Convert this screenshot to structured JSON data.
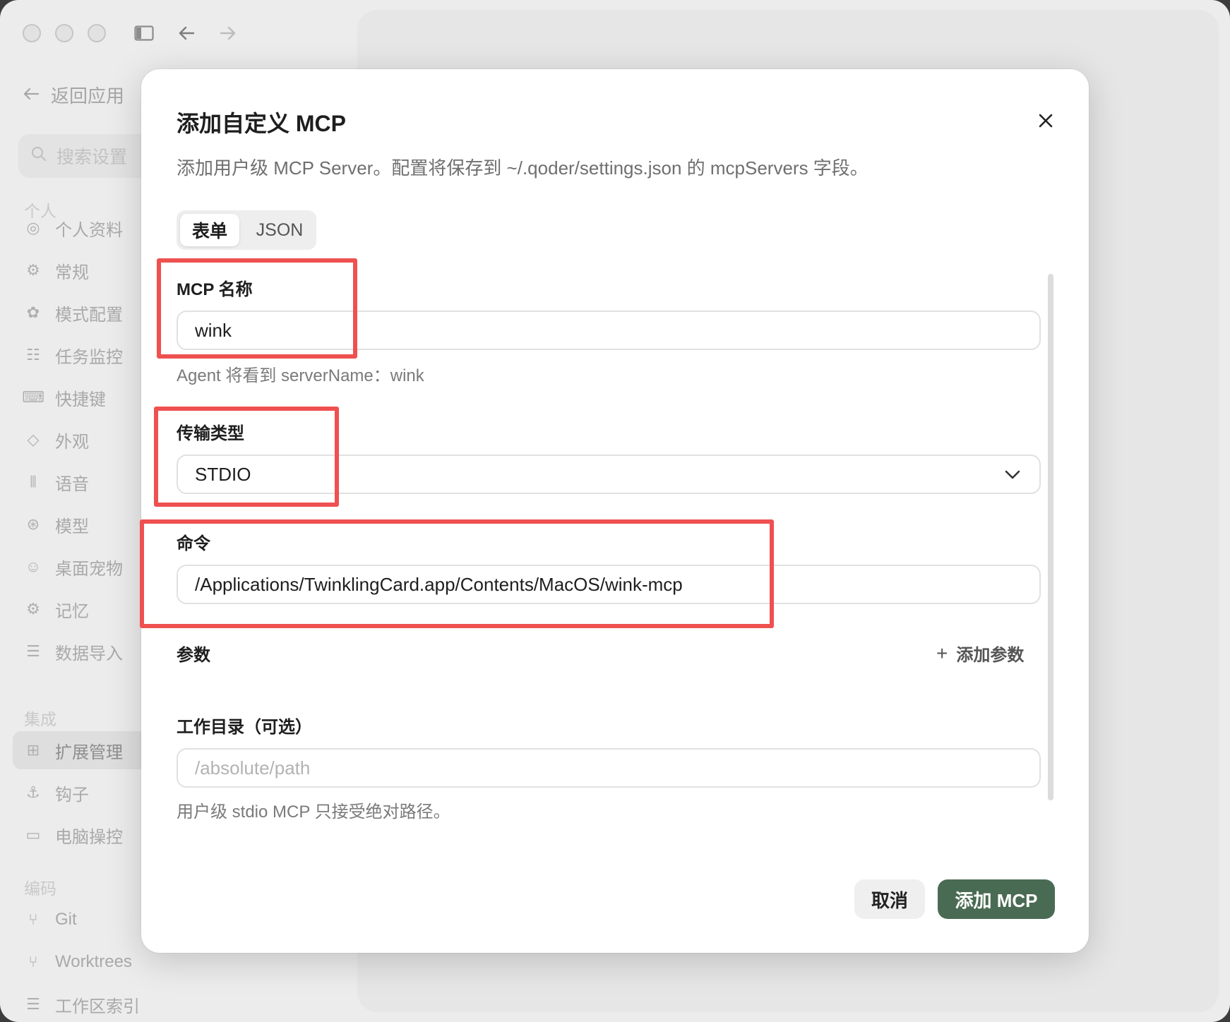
{
  "titlebar": {
    "sidebar_toggle_icon": "sidebar-toggle-icon",
    "back_icon": "arrow-left-icon",
    "forward_icon": "arrow-right-icon"
  },
  "sidebar": {
    "back_label": "返回应用",
    "search_placeholder": "搜索设置",
    "sections": {
      "personal": "个人",
      "integration": "集成",
      "coding": "编码"
    },
    "items": [
      {
        "label": "个人资料",
        "icon": "user-circle-icon"
      },
      {
        "label": "常规",
        "icon": "gear-icon"
      },
      {
        "label": "模式配置",
        "icon": "palette-icon"
      },
      {
        "label": "任务监控",
        "icon": "checklist-icon"
      },
      {
        "label": "快捷键",
        "icon": "keyboard-icon"
      },
      {
        "label": "外观",
        "icon": "paint-bucket-icon"
      },
      {
        "label": "语音",
        "icon": "waveform-icon"
      },
      {
        "label": "模型",
        "icon": "model-icon"
      },
      {
        "label": "桌面宠物",
        "icon": "pet-icon"
      },
      {
        "label": "记忆",
        "icon": "brain-icon"
      },
      {
        "label": "数据导入",
        "icon": "database-icon"
      },
      {
        "label": "扩展管理",
        "icon": "grid-icon",
        "active": true
      },
      {
        "label": "钩子",
        "icon": "anchor-icon"
      },
      {
        "label": "电脑操控",
        "icon": "monitor-icon"
      },
      {
        "label": "Git",
        "icon": "branch-icon"
      },
      {
        "label": "Worktrees",
        "icon": "fork-icon"
      },
      {
        "label": "工作区索引",
        "icon": "database-icon"
      }
    ]
  },
  "dialog": {
    "title": "添加自定义 MCP",
    "description": "添加用户级 MCP Server。配置将保存到 ~/.qoder/settings.json 的 mcpServers 字段。",
    "tabs": [
      {
        "label": "表单",
        "selected": true
      },
      {
        "label": "JSON",
        "selected": false
      }
    ],
    "name_label": "MCP 名称",
    "name_value": "wink",
    "name_hint": "Agent 将看到 serverName：wink",
    "transport_label": "传输类型",
    "transport_value": "STDIO",
    "command_label": "命令",
    "command_value": "/Applications/TwinklingCard.app/Contents/MacOS/wink-mcp",
    "args_label": "参数",
    "add_args_label": "添加参数",
    "workdir_label": "工作目录（可选）",
    "workdir_placeholder": "/absolute/path",
    "workdir_hint": "用户级 stdio MCP 只接受绝对路径。",
    "cancel_label": "取消",
    "submit_label": "添加 MCP"
  },
  "colors": {
    "primary_button": "#4a6b53",
    "annotation_red": "#ef5050"
  }
}
